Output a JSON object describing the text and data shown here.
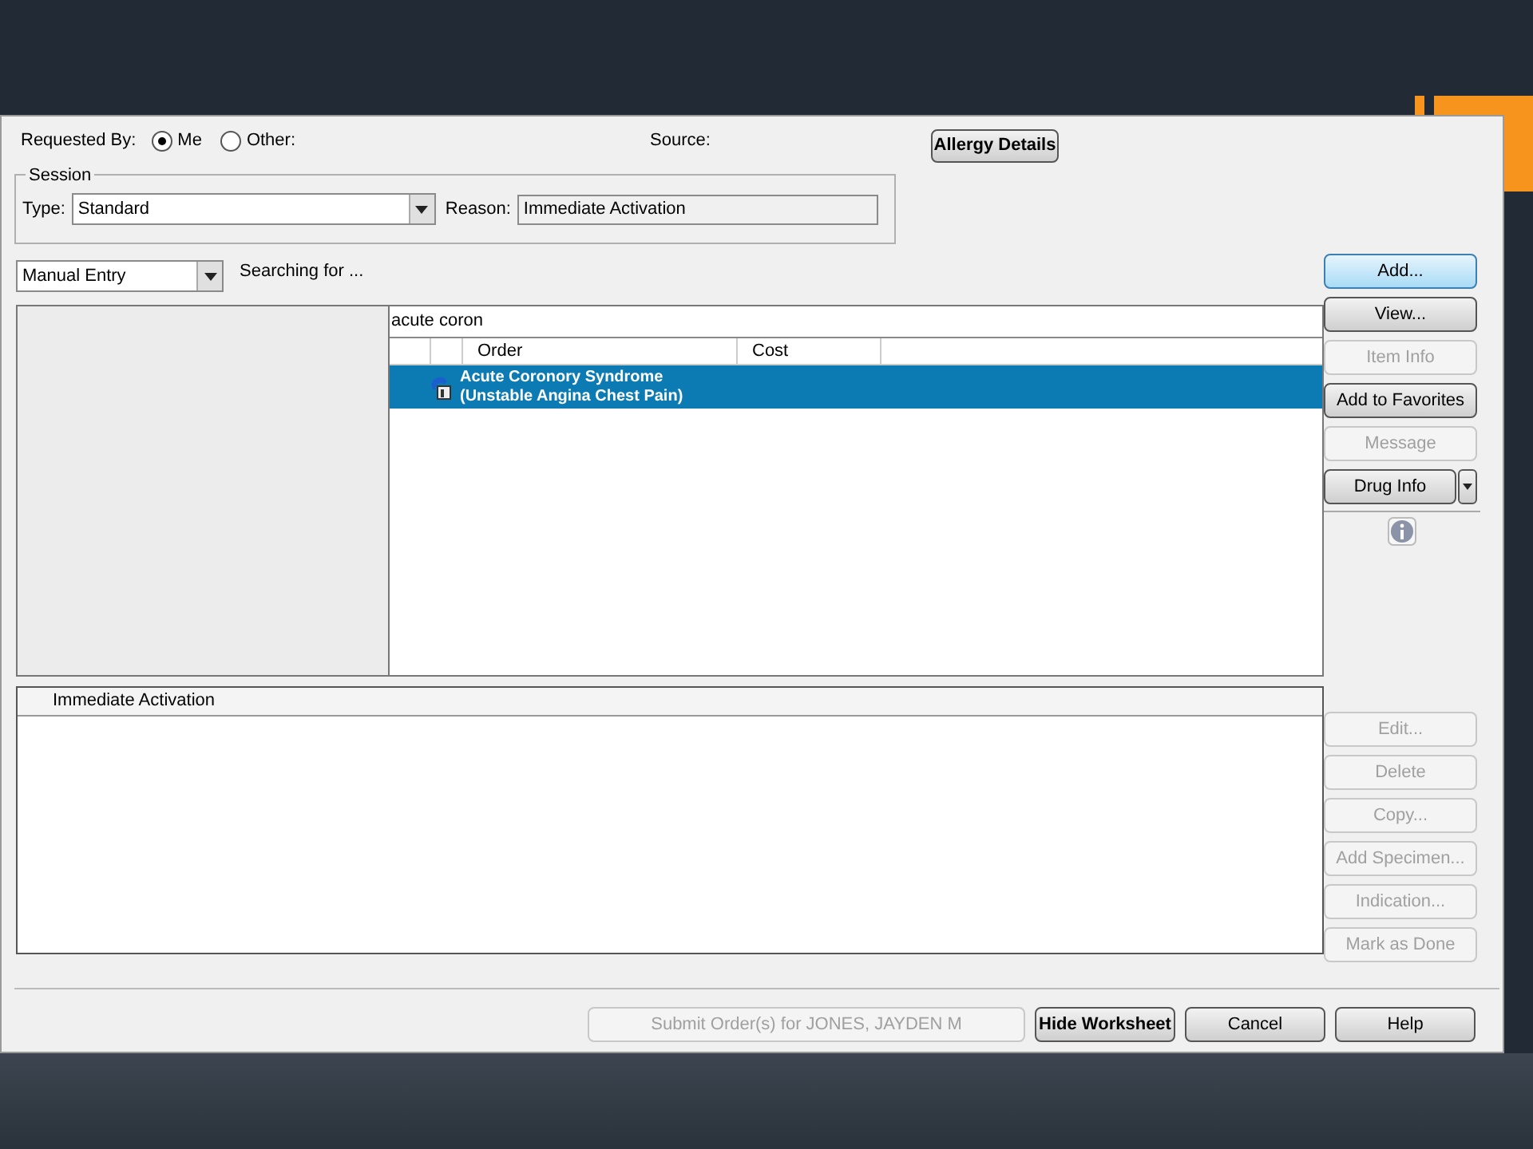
{
  "requested_by": {
    "label": "Requested By:",
    "options": [
      {
        "label": "Me",
        "selected": true
      },
      {
        "label": "Other:",
        "selected": false
      }
    ]
  },
  "source": {
    "label": "Source:"
  },
  "allergy_button": "Allergy Details",
  "session": {
    "title": "Session",
    "type_label": "Type:",
    "type_value": "Standard",
    "reason_label": "Reason:",
    "reason_value": "Immediate Activation"
  },
  "entry_mode": "Manual Entry",
  "searching_label": "Searching for ...",
  "search": {
    "value": "acute coron",
    "columns": [
      "Order",
      "Cost"
    ],
    "rows": [
      {
        "lines": [
          "Acute Coronory Syndrome",
          "(Unstable Angina Chest Pain)"
        ],
        "selected": true
      }
    ]
  },
  "side_buttons": [
    {
      "kind": "button",
      "label": "Add...",
      "default": true,
      "disabled": false
    },
    {
      "kind": "button",
      "label": "View...",
      "default": false,
      "disabled": false
    },
    {
      "kind": "button",
      "label": "Item Info",
      "default": false,
      "disabled": true
    },
    {
      "kind": "button",
      "label": "Add to Favorites",
      "default": false,
      "disabled": false
    },
    {
      "kind": "button",
      "label": "Message",
      "default": false,
      "disabled": true
    },
    {
      "kind": "split",
      "label": "Drug Info",
      "default": false,
      "disabled": false
    },
    {
      "kind": "separator"
    },
    {
      "kind": "info"
    }
  ],
  "worksheet": {
    "header": "Immediate Activation"
  },
  "lower_buttons": [
    {
      "label": "Edit...",
      "disabled": true
    },
    {
      "label": "Delete",
      "disabled": true
    },
    {
      "label": "Copy...",
      "disabled": true
    },
    {
      "label": "Add Specimen...",
      "disabled": true
    },
    {
      "label": "Indication...",
      "disabled": true
    },
    {
      "label": "Mark as Done",
      "disabled": true
    }
  ],
  "footer_buttons": [
    {
      "label": "Submit Order(s) for JONES, JAYDEN M",
      "disabled": true,
      "wide": true
    },
    {
      "label": "Hide Worksheet",
      "disabled": false,
      "wide": false
    },
    {
      "label": "Cancel",
      "disabled": false,
      "wide": false
    },
    {
      "label": "Help",
      "disabled": false,
      "wide": false
    }
  ]
}
